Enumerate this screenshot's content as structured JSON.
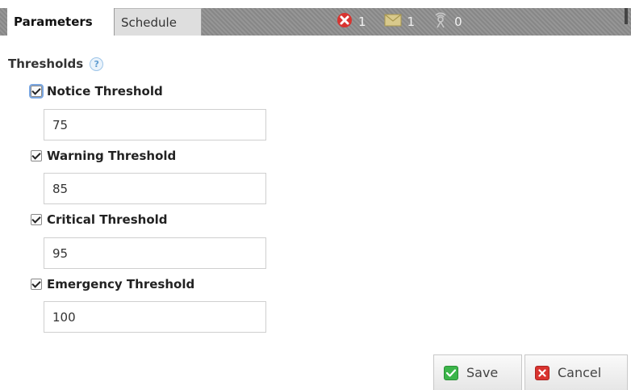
{
  "tabs": [
    {
      "label": "Parameters",
      "active": true
    },
    {
      "label": "Schedule",
      "active": false
    }
  ],
  "status": {
    "errors": {
      "icon": "error-x-icon",
      "count": "1",
      "color": "#d9332f"
    },
    "messages": {
      "icon": "envelope-icon",
      "count": "1",
      "color": "#c9b97a"
    },
    "notifications": {
      "icon": "satellite-icon",
      "count": "0",
      "color": "#b8b8b8"
    }
  },
  "section": {
    "label": "Thresholds",
    "help_icon": "help-question-icon",
    "help_text": "?"
  },
  "thresholds": [
    {
      "label": "Notice Threshold",
      "checked": true,
      "value": "75"
    },
    {
      "label": "Warning Threshold",
      "checked": true,
      "value": "85"
    },
    {
      "label": "Critical Threshold",
      "checked": true,
      "value": "95"
    },
    {
      "label": "Emergency Threshold",
      "checked": true,
      "value": "100"
    }
  ],
  "actions": {
    "save_label": "Save",
    "save_icon": "check-icon",
    "cancel_label": "Cancel",
    "cancel_icon": "close-icon"
  },
  "colors": {
    "tab_bar": "#8e8e8e",
    "save_green": "#3bb54a",
    "cancel_red": "#d9332f",
    "help_blue": "#5e9bd0"
  }
}
